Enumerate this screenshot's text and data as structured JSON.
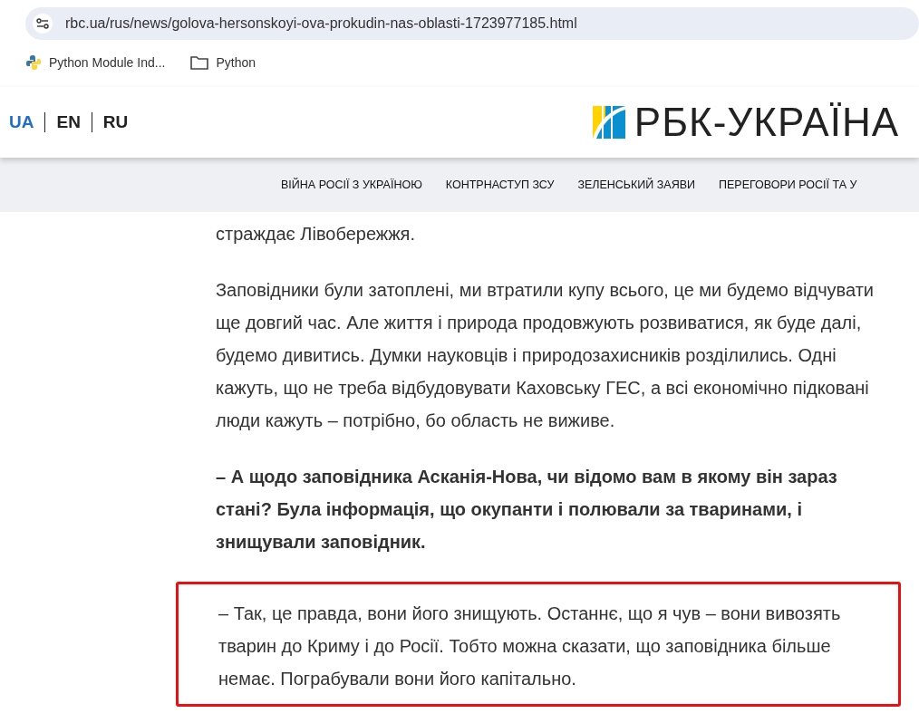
{
  "browser": {
    "url": "rbc.ua/rus/news/golova-hersonskoyi-ova-prokudin-nas-oblasti-1723977185.html",
    "bookmarks": [
      {
        "kind": "python",
        "label": "Python Module Ind..."
      },
      {
        "kind": "folder",
        "label": "Python"
      }
    ]
  },
  "header": {
    "languages": [
      {
        "label": "UA",
        "selected": true
      },
      {
        "label": "EN",
        "selected": false
      },
      {
        "label": "RU",
        "selected": false
      }
    ],
    "logo": "РБК-УКРАЇНА"
  },
  "nav": [
    "ВІЙНА РОСІЇ З УКРАЇНОЮ",
    "КОНТРНАСТУП ЗСУ",
    "ЗЕЛЕНСЬКИЙ ЗАЯВИ",
    "ПЕРЕГОВОРИ РОСІЇ ТА У"
  ],
  "article": [
    {
      "kind": "text",
      "highlighted": false,
      "text": "страждає Лівобережжя."
    },
    {
      "kind": "text",
      "highlighted": false,
      "text": "Заповідники були затоплені, ми втратили купу всього, це ми будемо відчувати ще довгий час. Але життя і природа продовжують розвиватися, як буде далі, будемо дивитись. Думки науковців і природозахисників розділились. Одні кажуть, що не треба відбудовувати Каховську ГЕС, а всі економічно підковані люди кажуть – потрібно, бо область не виживе."
    },
    {
      "kind": "question",
      "highlighted": false,
      "text": "– А щодо заповідника Асканія-Нова, чи відомо вам в якому він зараз стані? Була інформація, що окупанти і полювали за тваринами, і знищували заповідник."
    },
    {
      "kind": "text",
      "highlighted": true,
      "text": "– Так, це правда, вони його знищують. Останнє, що я чув – вони вивозять тварин до Криму і до Росії. Тобто можна сказати, що заповідника більше немає. Пограбували вони його капітально."
    }
  ]
}
